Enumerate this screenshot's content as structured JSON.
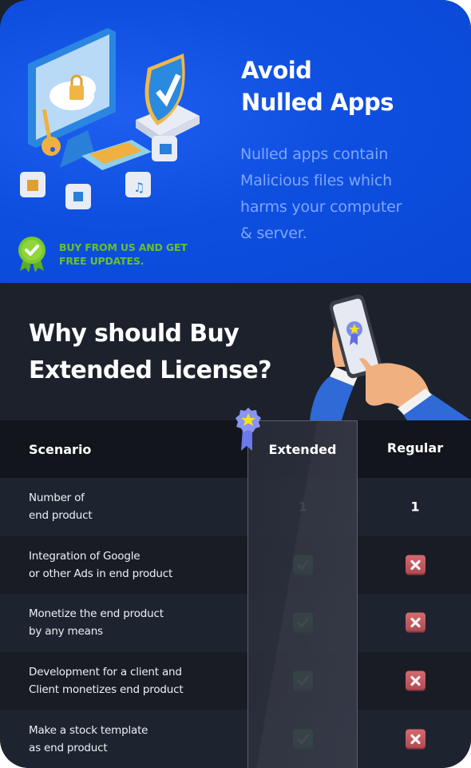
{
  "hero": {
    "title": "Avoid\nNulled Apps",
    "description": "Nulled apps contain\nMalicious files which\nharms your computer\n& server.",
    "badge_text": "BUY FROM US AND GET\nFREE UPDATES.",
    "illustration": "computer-security-illustration"
  },
  "why": {
    "title": "Why should Buy\nExtended License?",
    "illustration": "hand-holding-phone-illustration"
  },
  "colors": {
    "hero_bg": "#0a48d6",
    "badge_green": "#68c02a",
    "dark_bg": "#1d212c",
    "check_green": "#3aad51",
    "cross_red": "#c4575e"
  },
  "table": {
    "headers": {
      "scenario": "Scenario",
      "extended": "Extended",
      "regular": "Regular"
    },
    "rows": [
      {
        "scenario": "Number of\nend product",
        "extended": "1",
        "regular": "1"
      },
      {
        "scenario": "Integration of  Google\nor other Ads in end product",
        "extended": "check",
        "regular": "cross"
      },
      {
        "scenario": "Monetize the end product\nby any means",
        "extended": "check",
        "regular": "cross"
      },
      {
        "scenario": "Development for a client and\nClient monetizes end product",
        "extended": "check",
        "regular": "cross"
      },
      {
        "scenario": "Make a stock template\nas end product",
        "extended": "check",
        "regular": "cross"
      }
    ]
  }
}
